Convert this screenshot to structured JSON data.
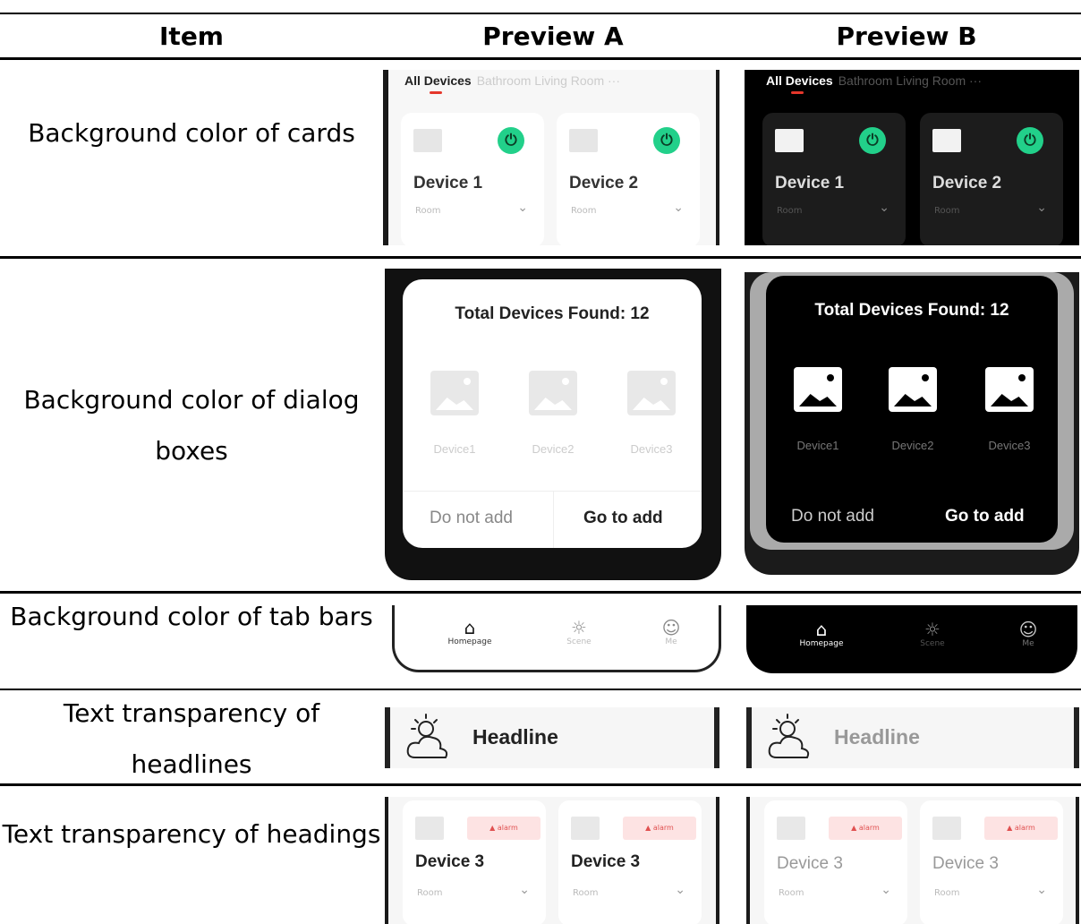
{
  "table": {
    "headers": [
      "Item",
      "Preview A",
      "Preview B"
    ],
    "rows": [
      {
        "item": "Background color of cards"
      },
      {
        "item": "Background color of dialog boxes"
      },
      {
        "item": "Background color of tab bars"
      },
      {
        "item": "Text transparency of headlines"
      },
      {
        "item": "Text transparency of headings"
      }
    ]
  },
  "cards_preview": {
    "tabs": {
      "active": "All Devices",
      "others": "Bathroom Living Room ···"
    },
    "devices": [
      {
        "name": "Device 1",
        "room": "Room"
      },
      {
        "name": "Device 2",
        "room": "Room"
      }
    ],
    "power_icon": "power-icon",
    "chevron_icon": "chevron-down-icon",
    "image_icon": "image-placeholder-icon"
  },
  "dialog_preview": {
    "title": "Total Devices Found: 12",
    "devices": [
      "Device1",
      "Device2",
      "Device3"
    ],
    "cancel_label": "Do not add",
    "confirm_label": "Go to add"
  },
  "tabbar_preview": {
    "items": [
      {
        "label": "Homepage",
        "icon": "home-icon"
      },
      {
        "label": "Scene",
        "icon": "sun-icon"
      },
      {
        "label": "Me",
        "icon": "user-icon"
      }
    ]
  },
  "headline_preview": {
    "text": "Headline",
    "icon": "cloud-sun-icon"
  },
  "headings_preview": {
    "badge": "▲ alarm",
    "devices": [
      {
        "name": "Device 3",
        "room": "Room"
      },
      {
        "name": "Device 3",
        "room": "Room"
      }
    ]
  },
  "colors": {
    "accent_green": "#22d08a",
    "accent_red": "#e5372b",
    "light_bg": "#f5f5f5",
    "dark_bg": "#000000"
  }
}
